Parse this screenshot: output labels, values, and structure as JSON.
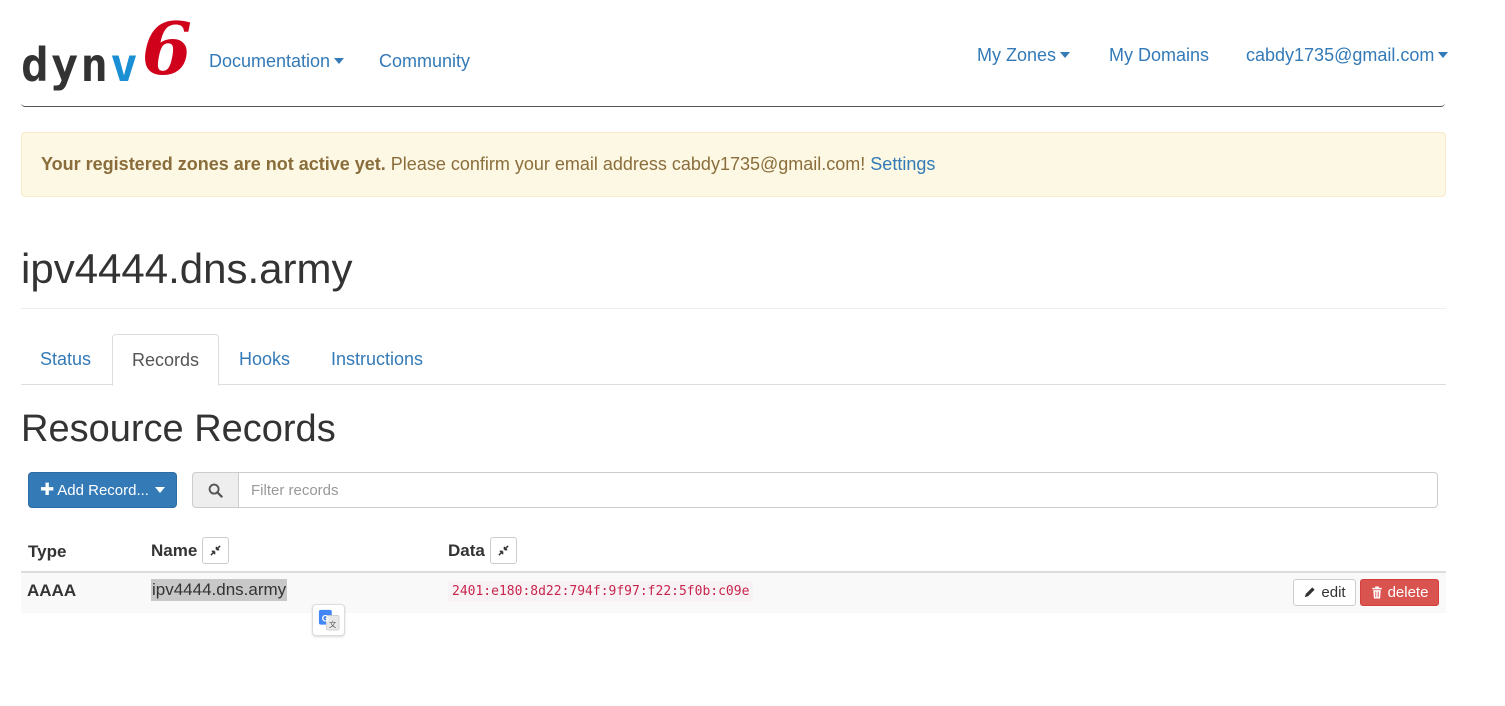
{
  "brand": {
    "logo_dyn": "dyn",
    "logo_v": "v",
    "logo_six": "6"
  },
  "nav": {
    "documentation": "Documentation",
    "community": "Community",
    "my_zones": "My Zones",
    "my_domains": "My Domains",
    "account": "cabdy1735@gmail.com"
  },
  "alert": {
    "strong": "Your registered zones are not active yet.",
    "message": "Please confirm your email address cabdy1735@gmail.com!",
    "link": "Settings"
  },
  "page": {
    "title": "ipv4444.dns.army"
  },
  "tabs": [
    {
      "label": "Status",
      "active": false
    },
    {
      "label": "Records",
      "active": true
    },
    {
      "label": "Hooks",
      "active": false
    },
    {
      "label": "Instructions",
      "active": false
    }
  ],
  "section": {
    "title": "Resource Records"
  },
  "toolbar": {
    "add_label": "Add Record...",
    "filter_placeholder": "Filter records"
  },
  "table": {
    "headers": {
      "type": "Type",
      "name": "Name",
      "data": "Data"
    },
    "rows": [
      {
        "type": "AAAA",
        "name": "ipv4444.dns.army",
        "data": "2401:e180:8d22:794f:9f97:f22:5f0b:c09e"
      }
    ],
    "actions": {
      "edit": "edit",
      "delete": "delete"
    }
  },
  "colors": {
    "link": "#337ab7",
    "alert_bg": "#fcf8e3",
    "alert_text": "#8a6d3b",
    "primary": "#337ab7",
    "danger": "#d9534f",
    "code": "#c7254e",
    "logo_red": "#d0021b",
    "logo_blue": "#1a8fd3"
  },
  "icons": [
    "search-icon",
    "plus-icon",
    "caret-down-icon",
    "compress-icon",
    "pencil-icon",
    "trash-icon",
    "google-translate-icon"
  ]
}
